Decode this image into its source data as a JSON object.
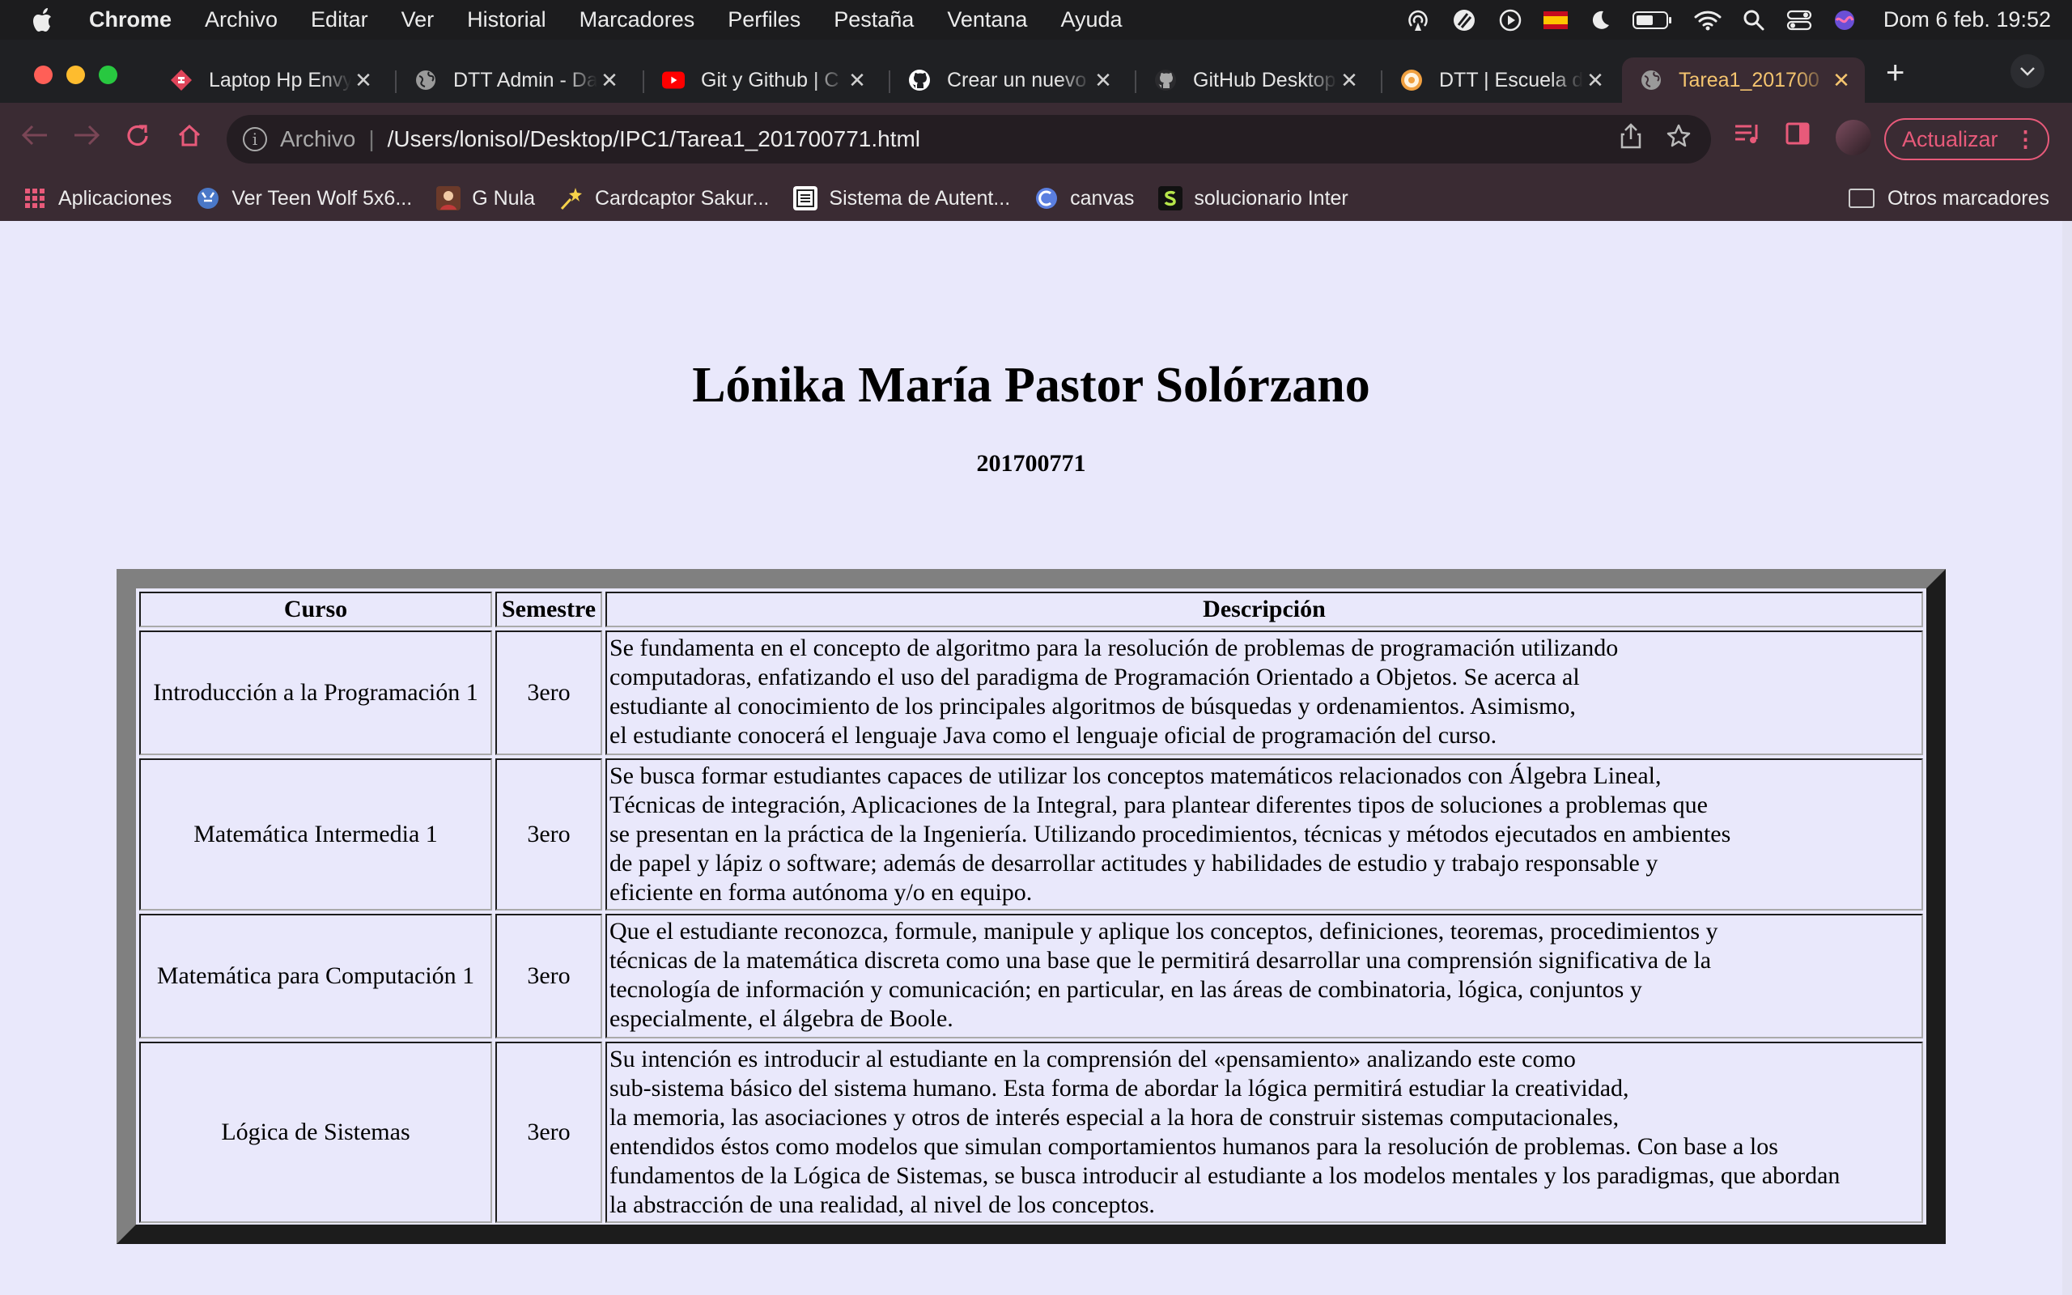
{
  "menubar": {
    "app": "Chrome",
    "items": [
      "Archivo",
      "Editar",
      "Ver",
      "Historial",
      "Marcadores",
      "Perfiles",
      "Pestaña",
      "Ventana",
      "Ayuda"
    ],
    "clock": "Dom 6 feb.  19:52"
  },
  "tabs": [
    {
      "title": "Laptop Hp Envy",
      "favicon": "stackbit-icon",
      "color": "#e0455a"
    },
    {
      "title": "DTT Admin - Da",
      "favicon": "globe-icon",
      "color": "#9a9a9a"
    },
    {
      "title": "Git y Github | C",
      "favicon": "youtube-icon",
      "color": "#ff0000"
    },
    {
      "title": "Crear un nuevo",
      "favicon": "github-icon",
      "color": "#ffffff"
    },
    {
      "title": "GitHub Desktop",
      "favicon": "github-icon",
      "color": "#ffffff"
    },
    {
      "title": "DTT | Escuela d",
      "favicon": "dtt-icon",
      "color": "#f0a040"
    },
    {
      "title": "Tarea1_201700",
      "favicon": "globe-icon",
      "color": "#9a9a9a",
      "active": true
    }
  ],
  "toolbar": {
    "scheme": "Archivo",
    "url": "/Users/lonisol/Desktop/IPC1/Tarea1_201700771.html",
    "update_label": "Actualizar"
  },
  "bookmarks": [
    {
      "label": "Aplicaciones",
      "icon": "apps-grid-icon"
    },
    {
      "label": "Ver Teen Wolf 5x6...",
      "icon": "wolf-icon"
    },
    {
      "label": "G Nula",
      "icon": "anime-icon"
    },
    {
      "label": "Cardcaptor Sakur...",
      "icon": "star-wand-icon"
    },
    {
      "label": "Sistema de Autent...",
      "icon": "usac-icon"
    },
    {
      "label": "canvas",
      "icon": "canvas-icon"
    },
    {
      "label": "solucionario Inter",
      "icon": "s-icon"
    }
  ],
  "bookmarks_other": "Otros marcadores",
  "page": {
    "name": "Lónika María Pastor Solórzano",
    "carnet": "201700771",
    "table": {
      "headers": [
        "Curso",
        "Semestre",
        "Descripción"
      ],
      "rows": [
        {
          "course": "Introducción a la Programación 1",
          "semester": "3ero",
          "description": "Se fundamenta en el concepto de algoritmo para la resolución de problemas de programación utilizando\ncomputadoras, enfatizando el uso del paradigma de Programación Orientado a Objetos. Se acerca al\nestudiante al conocimiento de los principales algoritmos de búsquedas y ordenamientos. Asimismo,\nel estudiante conocerá el lenguaje Java como el lenguaje oficial de programación del curso."
        },
        {
          "course": "Matemática Intermedia 1",
          "semester": "3ero",
          "description": "Se busca formar estudiantes capaces de utilizar los conceptos matemáticos relacionados con Álgebra Lineal,\nTécnicas de integración, Aplicaciones de la Integral, para plantear diferentes tipos de soluciones a problemas que\nse presentan en la práctica de la Ingeniería. Utilizando procedimientos, técnicas y métodos ejecutados en ambientes\nde papel y lápiz o software; además de desarrollar actitudes y habilidades de estudio y trabajo responsable y\neficiente en forma autónoma y/o en equipo."
        },
        {
          "course": "Matemática para Computación 1",
          "semester": "3ero",
          "description": "Que el estudiante reconozca, formule, manipule y aplique los conceptos, definiciones, teoremas, procedimientos y\ntécnicas de la matemática discreta como una base que le permitirá desarrollar una comprensión significativa de la\ntecnología de información y comunicación; en particular, en las áreas de combinatoria, lógica, conjuntos y\nespecialmente, el álgebra de Boole."
        },
        {
          "course": "Lógica de Sistemas",
          "semester": "3ero",
          "description": "Su intención es introducir al estudiante en la comprensión del «pensamiento» analizando este como\nsub-sistema básico del sistema humano. Esta forma de abordar la lógica permitirá estudiar la creatividad,\nla memoria, las asociaciones y otros de interés especial a la hora de construir sistemas computacionales,\nentendidos éstos como modelos que simulan comportamientos humanos para la resolución de problemas. Con base a los\nfundamentos de la Lógica de Sistemas, se busca introducir al estudiante a los modelos mentales y los paradigmas, que abordan\nla abstracción de una realidad, al nivel de los conceptos."
        }
      ]
    }
  },
  "colors": {
    "accent": "#e85a7a",
    "active_tab_text": "#f5c56f",
    "page_bg": "#e9e8fb"
  }
}
